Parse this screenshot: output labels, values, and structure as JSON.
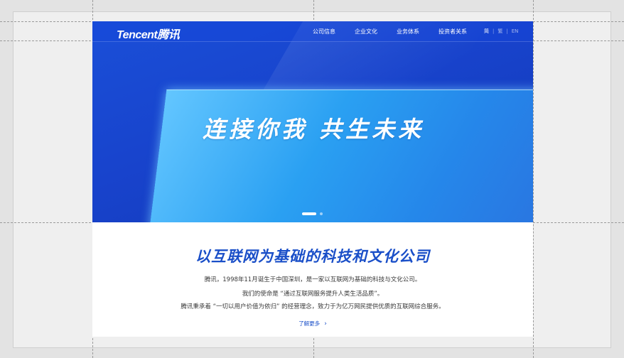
{
  "header": {
    "logo": "Tencent腾讯",
    "nav": [
      "公司信息",
      "企业文化",
      "业务体系",
      "投资者关系"
    ],
    "lang": [
      "简",
      "繁",
      "EN"
    ],
    "lang_sep": "|"
  },
  "hero": {
    "slogan": "连接你我 共生未来",
    "carousel": {
      "slides": 2,
      "active": 1
    }
  },
  "content": {
    "headline": "以互联网为基础的科技和文化公司",
    "paragraphs": [
      "腾讯，1998年11月诞生于中国深圳，是一家以互联网为基础的科技与文化公司。",
      "我们的使命是 “通过互联网服务提升人类生活品质”。",
      "腾讯秉承着 “一切以用户价值为依归” 的经营理念，致力于为亿万网民提供优质的互联网综合服务。"
    ],
    "more_link": "了解更多"
  },
  "colors": {
    "brand_blue": "#1a4fd8",
    "headline_blue": "#1a4fc8",
    "panel_cyan": "#63c6ff"
  },
  "icons": {
    "more": "chevron-right-icon"
  }
}
